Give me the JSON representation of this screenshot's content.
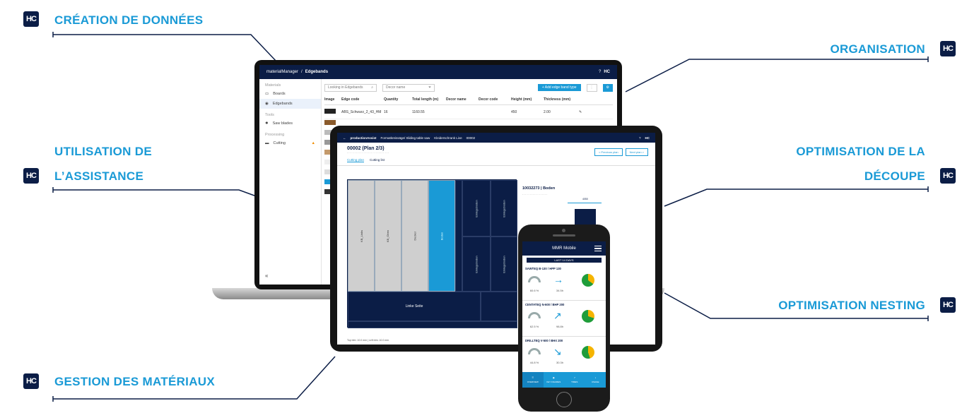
{
  "logo_text": "HC",
  "labels": {
    "creation": "CRÉATION DE DONNÉES",
    "utilisation_l1": "UTILISATION DE",
    "utilisation_l2": "L’ASSISTANCE",
    "gestion": "GESTION DES MATÉRIAUX",
    "organisation": "ORGANISATION",
    "optimisation_l1": "OPTIMISATION DE LA",
    "optimisation_l2": "DÉCOUPE",
    "nesting": "OPTIMISATION NESTING"
  },
  "colors": {
    "accent": "#1a9ad6",
    "navy": "#0b1d46"
  },
  "laptop": {
    "breadcrumb_app": "materialManager",
    "breadcrumb_sep": "/",
    "breadcrumb_page": "Edgebands",
    "sidebar": {
      "section_materials": "Materials",
      "boards": "Boards",
      "edgebands": "Edgebands",
      "section_tools": "Tools",
      "saw_blades": "Saw blades",
      "section_processing": "Processing",
      "cutting": "Cutting"
    },
    "search_placeholder": "Looking in Edgebands",
    "decor_filter": "Decor name",
    "add_button": "+ Add edge band type",
    "columns": [
      "Image",
      "Edge code",
      "Quantity",
      "Total length (m)",
      "Decor name",
      "Decor code",
      "Height (mm)",
      "Thickness (mm)"
    ],
    "rows": [
      {
        "code": "ABS_Schwarz_2_43_HM",
        "qty": "16",
        "length": "1160.55",
        "height": "450",
        "thickness": "2.00"
      }
    ]
  },
  "tablet": {
    "app": "productionAssist",
    "path": "Formatkreissäge/ Sliding table saw",
    "sub": "Kleiderschrank Live",
    "order": "00002",
    "plan_title": "00002 (Plan 2/3)",
    "tab_plan": "Cutting plan",
    "tab_list": "Cutting list",
    "prev": "< Previous plan",
    "next": "Next plan >",
    "part_title": "10032273 | Boden",
    "dimension": "4050",
    "footer": "Top trim: 10.0 mm | Left trim: 10.0 mm",
    "big_piece": "Linke Seite"
  },
  "phone": {
    "title": "MMR Mobile",
    "filter": "LAST 14 DAYS",
    "machines": [
      {
        "name": "SAWTEQ B-130 / HPP 130",
        "kpi1": "60.6 %",
        "kpi2": "34.5h",
        "arrow": "→"
      },
      {
        "name": "CENTATEQ N-600 / BHP 200",
        "kpi1": "62.5 %",
        "kpi2": "98.8h",
        "arrow": "↗"
      },
      {
        "name": "DRILLTEQ V-500 / BHX 200",
        "kpi1": "44.8 %",
        "kpi2": "30.3h",
        "arrow": "↘"
      }
    ],
    "nav": [
      "OVERVIEW",
      "KEY FIGURES",
      "TIMES",
      "USAGE"
    ]
  }
}
